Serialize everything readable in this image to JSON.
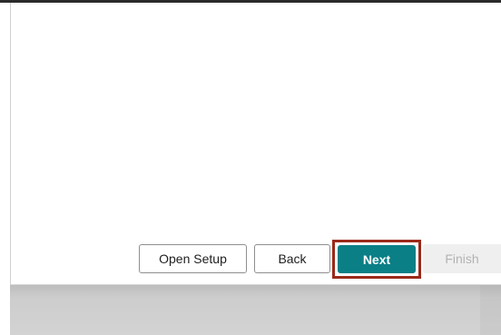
{
  "wizard": {
    "buttons": {
      "open_setup_label": "Open Setup",
      "back_label": "Back",
      "next_label": "Next",
      "finish_label": "Finish"
    },
    "finish_disabled": true,
    "highlighted_button": "next"
  },
  "colors": {
    "primary_button": "#0b7f86",
    "highlight_border": "#9b2a1a",
    "disabled_text": "#b3b3b3"
  }
}
